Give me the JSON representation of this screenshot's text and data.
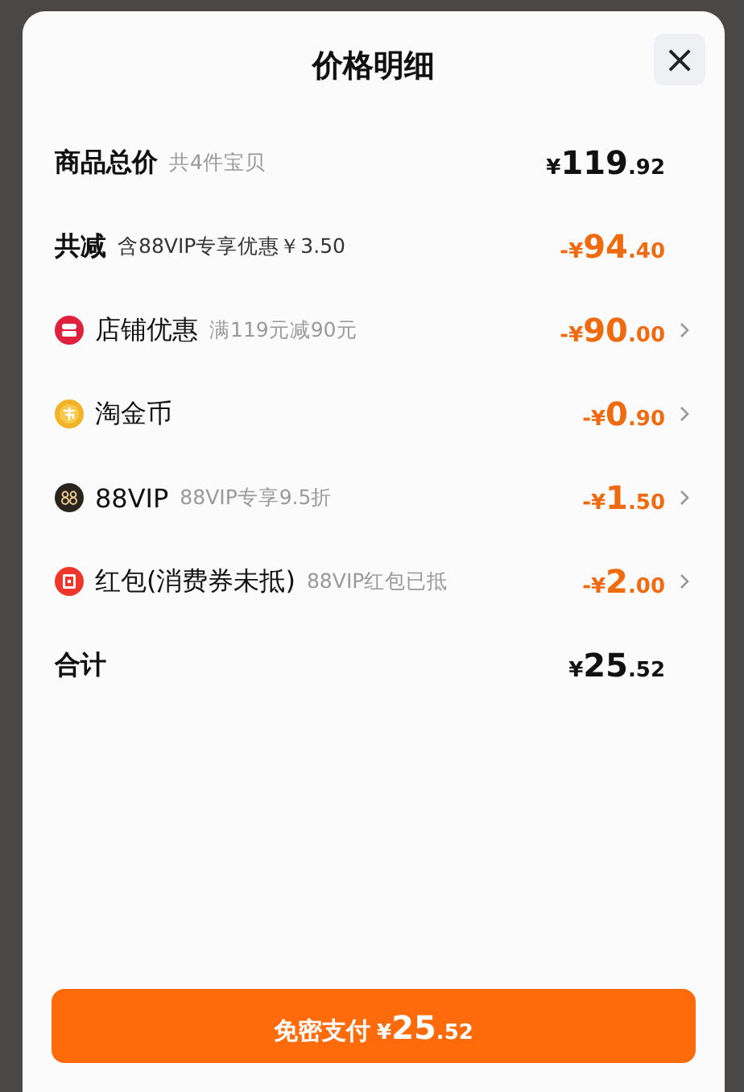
{
  "sheet": {
    "title": "价格明细",
    "close": "×"
  },
  "rows": [
    {
      "kind": "total",
      "label": "商品总价",
      "note": "共4件宝贝",
      "price": {
        "lead": "¥",
        "whole": "119",
        "fraction": ".92"
      }
    },
    {
      "kind": "summary",
      "label": "共减",
      "note": "含88VIP专享优惠￥3.50",
      "price": {
        "lead": "-¥",
        "whole": "94",
        "fraction": ".40"
      }
    },
    {
      "kind": "discount",
      "label": "店铺优惠",
      "note": "满119元减90元",
      "price": {
        "lead": "-¥",
        "whole": "90",
        "fraction": ".00"
      }
    },
    {
      "kind": "discount",
      "label": "淘金币",
      "price": {
        "lead": "-¥",
        "whole": "0",
        "fraction": ".90"
      }
    },
    {
      "kind": "discount",
      "label": "88VIP",
      "note": "88VIP专享9.5折",
      "price": {
        "lead": "-¥",
        "whole": "1",
        "fraction": ".50"
      }
    },
    {
      "kind": "discount",
      "label": "红包(消费券未抵)",
      "note": "88VIP红包已抵",
      "price": {
        "lead": "-¥",
        "whole": "2",
        "fraction": ".00"
      }
    },
    {
      "kind": "total",
      "label": "合计",
      "price": {
        "lead": "¥",
        "whole": "25",
        "fraction": ".52"
      }
    }
  ],
  "pay_button": {
    "label": "免密支付",
    "price": {
      "lead": "¥",
      "whole": "25",
      "fraction": ".52"
    }
  }
}
